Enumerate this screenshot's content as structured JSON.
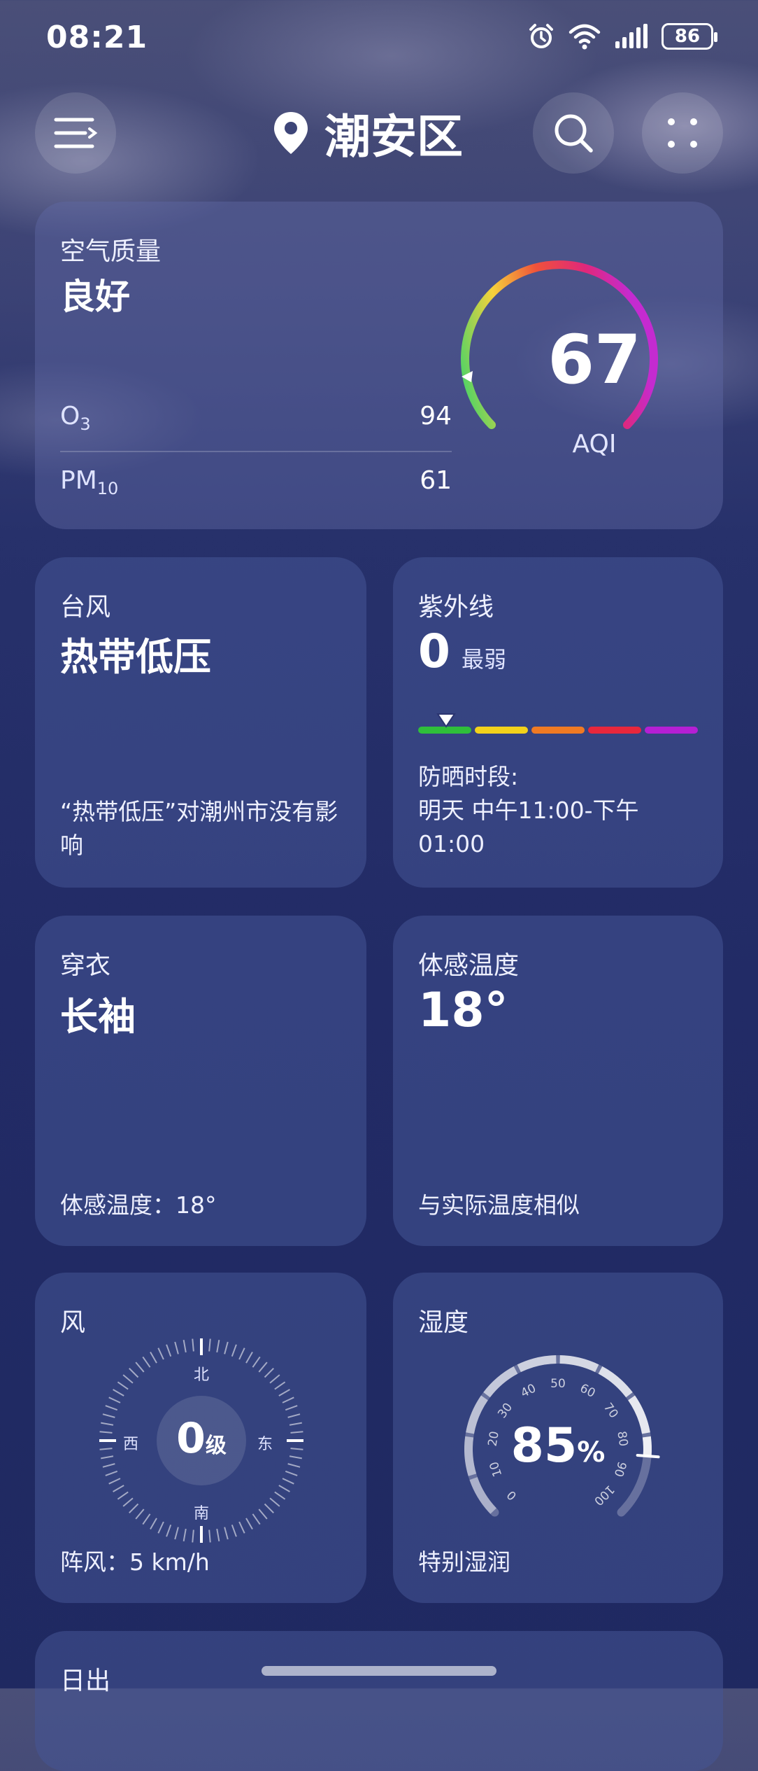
{
  "status": {
    "time": "08:21",
    "battery": "86"
  },
  "header": {
    "city": "潮安区"
  },
  "air": {
    "title": "空气质量",
    "level": "良好",
    "aqi_value": "67",
    "aqi_label": "AQI",
    "pollutants": [
      {
        "name": "O",
        "sub": "3",
        "value": "94"
      },
      {
        "name": "PM",
        "sub": "10",
        "value": "61"
      }
    ]
  },
  "typhoon": {
    "title": "台风",
    "value": "热带低压",
    "note": "“热带低压”对潮州市没有影响"
  },
  "uv": {
    "title": "紫外线",
    "index": "0",
    "level": "最弱",
    "protect_label": "防晒时段:",
    "protect_time": "明天 中午11:00-下午01:00",
    "segment_colors": [
      "#2fbf3a",
      "#f3d21b",
      "#f07a23",
      "#e8273c",
      "#b51fd4"
    ],
    "level_fraction": 0.1
  },
  "clothing": {
    "title": "穿衣",
    "value": "长袖",
    "note": "体感温度：18°"
  },
  "feels": {
    "title": "体感温度",
    "value": "18°",
    "note": "与实际温度相似"
  },
  "wind": {
    "title": "风",
    "level": "0",
    "unit": "级",
    "north": "北",
    "south": "南",
    "east": "东",
    "west": "西",
    "gust": "阵风：5 km/h"
  },
  "humidity": {
    "title": "湿度",
    "value": "85",
    "unit": "%",
    "note": "特别湿润",
    "ticks": [
      "0",
      "10",
      "20",
      "30",
      "40",
      "50",
      "60",
      "70",
      "80",
      "90",
      "100"
    ]
  },
  "sunrise": {
    "title": "日出"
  },
  "colors": {
    "aqi_gradient": [
      "#3bd36b",
      "#f6d23b",
      "#f0523a",
      "#e0287a",
      "#c42bd0"
    ]
  }
}
